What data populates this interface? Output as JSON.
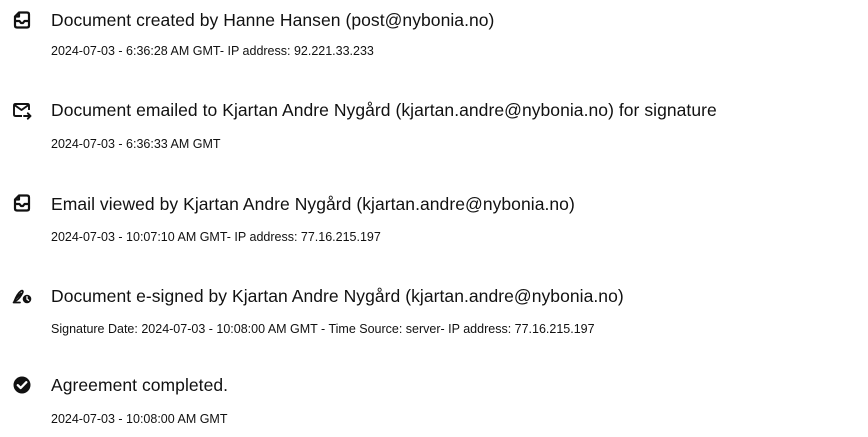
{
  "audit_trail": {
    "events": [
      {
        "icon": "document-icon",
        "title": "Document created by Hanne Hansen (post@nybonia.no)",
        "detail": "2024-07-03 - 6:36:28 AM GMT- IP address: 92.221.33.233"
      },
      {
        "icon": "email-send-icon",
        "title": "Document emailed to Kjartan Andre Nygård (kjartan.andre@nybonia.no) for signature",
        "detail": "2024-07-03 - 6:36:33 AM GMT"
      },
      {
        "icon": "document-icon",
        "title": "Email viewed by Kjartan Andre Nygård (kjartan.andre@nybonia.no)",
        "detail": "2024-07-03 - 10:07:10 AM GMT- IP address: 77.16.215.197"
      },
      {
        "icon": "signature-icon",
        "title": "Document e-signed by Kjartan Andre Nygård (kjartan.andre@nybonia.no)",
        "detail": "Signature Date: 2024-07-03 - 10:08:00 AM GMT - Time Source: server- IP address: 77.16.215.197"
      },
      {
        "icon": "check-circle-icon",
        "title": "Agreement completed.",
        "detail": "2024-07-03 - 10:08:00 AM GMT"
      }
    ]
  }
}
